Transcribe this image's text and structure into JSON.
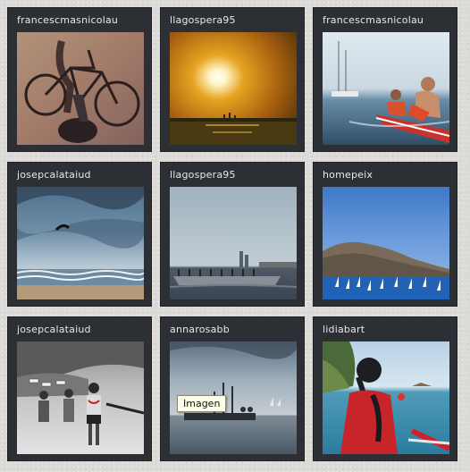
{
  "photos": [
    {
      "username": "francescmasnicolau",
      "scene": "bicycle-shadow"
    },
    {
      "username": "llagospera95",
      "scene": "sunset-sea"
    },
    {
      "username": "francescmasnicolau",
      "scene": "kayak-harbor"
    },
    {
      "username": "josepcalataiud",
      "scene": "kitesurf-storm"
    },
    {
      "username": "llagospera95",
      "scene": "rowing-boat-city"
    },
    {
      "username": "homepeix",
      "scene": "sailboats-mountain"
    },
    {
      "username": "josepcalataiud",
      "scene": "beach-people-bw"
    },
    {
      "username": "annarosabb",
      "scene": "dock-boat-sunset"
    },
    {
      "username": "lidiabart",
      "scene": "kayak-woman"
    }
  ],
  "tooltip": {
    "text": "Imagen"
  }
}
